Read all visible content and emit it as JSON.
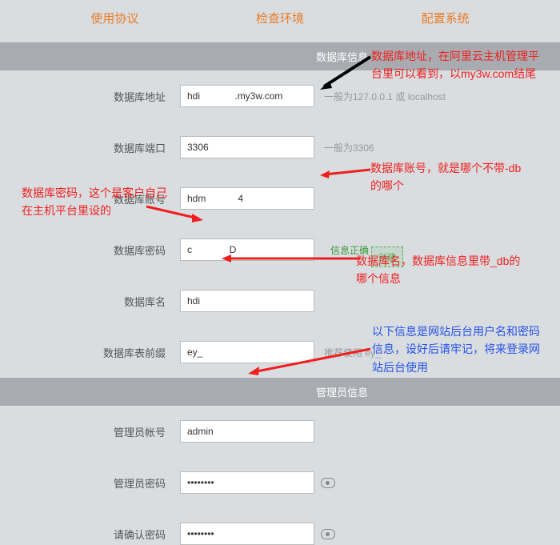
{
  "tabs": {
    "agreement": "使用协议",
    "env": "检查环境",
    "config": "配置系统"
  },
  "sections": {
    "db_info": "数据库信息",
    "admin_info": "管理员信息"
  },
  "fields": {
    "db_host": {
      "label": "数据库地址",
      "value": "hdi             .my3w.com",
      "hint": "一般为127.0.0.1 或 localhost"
    },
    "db_port": {
      "label": "数据库端口",
      "value": "3306",
      "hint": "一般为3306"
    },
    "db_user": {
      "label": "数据库账号",
      "value": "hdm            4"
    },
    "db_pass": {
      "label": "数据库密码",
      "value": "c              D",
      "status": "信息正确"
    },
    "db_name": {
      "label": "数据库名",
      "value": "hdi",
      "create": "创建"
    },
    "db_prefix": {
      "label": "数据库表前缀",
      "value": "ey_",
      "hint": "推荐使用 ey_"
    },
    "admin_user": {
      "label": "管理员帐号",
      "value": "admin"
    },
    "admin_pass": {
      "label": "管理员密码",
      "value": "••••••••"
    },
    "admin_pass2": {
      "label": "请确认密码",
      "value": "••••••••"
    }
  },
  "annotations": {
    "db_host_note": "数据库地址，在阿里云主机管理平台里可以看到，以my3w.com结尾",
    "db_user_note": "数据库账号，就是哪个不带-db的哪个",
    "db_pass_note": "数据库密码，这个是客户自己在主机平台里设的",
    "db_name_note": "数据库名，数据库信息里带_db的哪个信息",
    "admin_note": "以下信息是网站后台用户名和密码信息，设好后请牢记，将来登录网站后台使用"
  }
}
